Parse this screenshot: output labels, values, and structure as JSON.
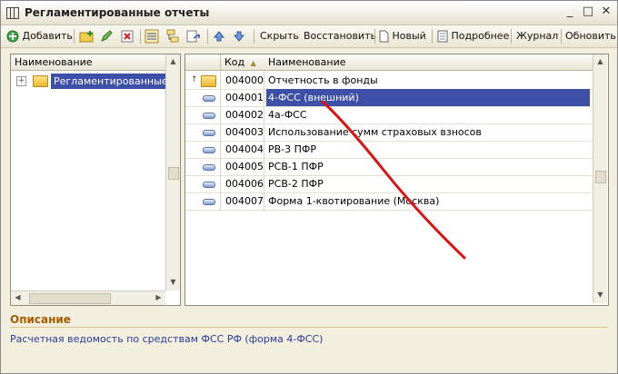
{
  "window": {
    "title": "Регламентированные отчеты"
  },
  "toolbar": {
    "add": "Добавить",
    "hide": "Скрыть",
    "restore": "Восстановить",
    "new": "Новый",
    "details": "Подробнее",
    "journal": "Журнал",
    "refresh": "Обновить"
  },
  "tree": {
    "header": "Наименование",
    "item": "Регламентированные от"
  },
  "table": {
    "header_code": "Код",
    "header_name": "Наименование",
    "rows": [
      {
        "code": "004000",
        "name": "Отчетность в фонды",
        "type": "folder"
      },
      {
        "code": "004001",
        "name": "4-ФСС (внешний)",
        "type": "doc"
      },
      {
        "code": "004002",
        "name": "4а-ФСС",
        "type": "doc"
      },
      {
        "code": "004003",
        "name": "Использование сумм страховых взносов",
        "type": "doc"
      },
      {
        "code": "004004",
        "name": "РВ-3 ПФР",
        "type": "doc"
      },
      {
        "code": "004005",
        "name": "РСВ-1 ПФР",
        "type": "doc"
      },
      {
        "code": "004006",
        "name": "РСВ-2 ПФР",
        "type": "doc"
      },
      {
        "code": "004007",
        "name": "Форма 1-квотирование (Москва)",
        "type": "doc"
      }
    ],
    "selected_index": 1
  },
  "description": {
    "label": "Описание",
    "text": "Расчетная ведомость по средствам ФСС РФ (форма 4-ФСС)"
  },
  "colors": {
    "selection": "#3d4fa6",
    "annotation_arrow": "#e01010",
    "description_label": "#a65c00"
  }
}
